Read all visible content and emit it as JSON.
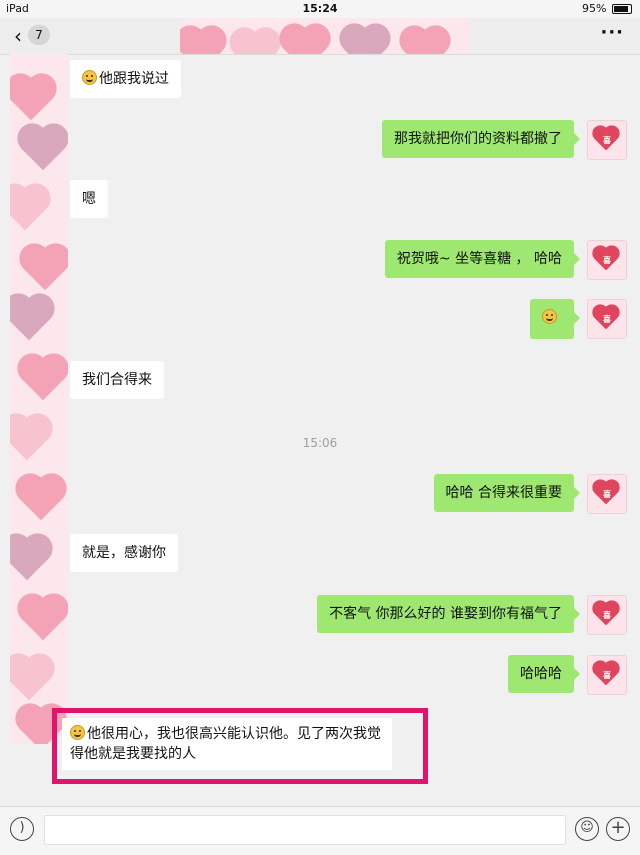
{
  "status": {
    "device": "iPad",
    "time": "15:24",
    "battery": "95%"
  },
  "nav": {
    "back_icon": "chevron-left-icon",
    "unread_count": "7",
    "more_label": "···"
  },
  "chat": {
    "timestamp": "15:06",
    "messages": [
      {
        "side": "in",
        "text": "他跟我说过",
        "emoji": "grin"
      },
      {
        "side": "out",
        "text": "那我就把你们的资料都撤了"
      },
      {
        "side": "in",
        "text": "嗯"
      },
      {
        "side": "out",
        "text": "祝贺哦~ 坐等喜糖 ， 哈哈"
      },
      {
        "side": "out",
        "text": "",
        "emoji": "smile"
      },
      {
        "side": "in",
        "text": "我们合得来"
      },
      {
        "side": "out",
        "text": "哈哈  合得来很重要"
      },
      {
        "side": "in",
        "text": "就是，感谢你"
      },
      {
        "side": "out",
        "text": "不客气   你那么好的 谁娶到你有福气了"
      },
      {
        "side": "out",
        "text": "哈哈哈"
      },
      {
        "side": "in",
        "text": "他很用心，我也很高兴能认识他。见了两次我觉得他就是我要找的人",
        "emoji": "smile",
        "highlighted": true
      }
    ]
  },
  "input": {
    "voice_icon": "voice-icon",
    "emoji_icon": "emoji-icon",
    "plus_icon": "plus-icon"
  },
  "colors": {
    "outgoing_bubble": "#9ee871",
    "incoming_bubble": "#ffffff",
    "highlight_border": "#e0136d"
  }
}
